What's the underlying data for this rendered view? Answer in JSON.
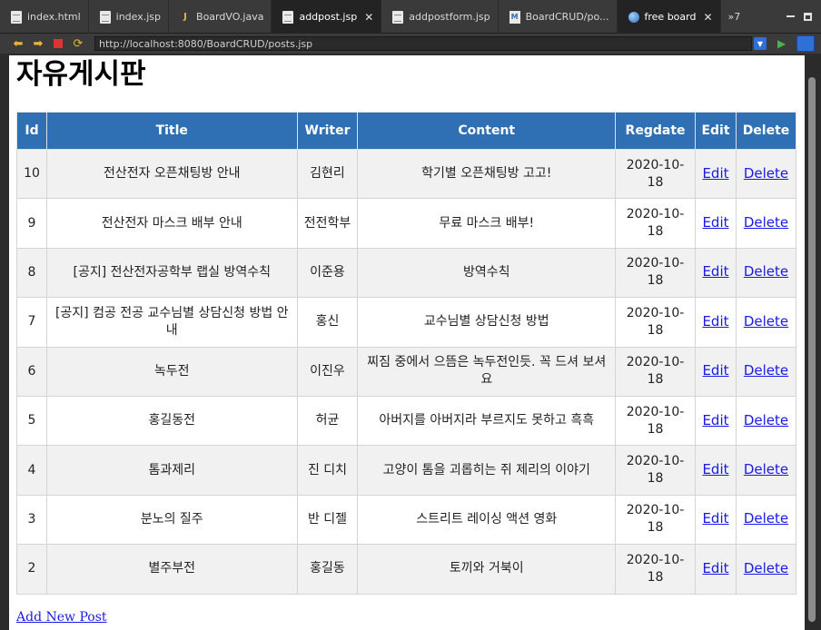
{
  "tabs": [
    {
      "label": "index.html",
      "icon": "html-file-icon",
      "active": false
    },
    {
      "label": "index.jsp",
      "icon": "jsp-file-icon",
      "active": false
    },
    {
      "label": "BoardVO.java",
      "icon": "java-file-icon",
      "active": false
    },
    {
      "label": "addpost.jsp",
      "icon": "jsp-file-icon",
      "active": true,
      "closable": true
    },
    {
      "label": "addpostform.jsp",
      "icon": "jsp-file-icon",
      "active": false
    },
    {
      "label": "BoardCRUD/po...",
      "icon": "web-file-icon",
      "active": false
    },
    {
      "label": "free board",
      "icon": "globe-icon",
      "active": true,
      "closable": true
    }
  ],
  "tab_overflow": "»7",
  "address": {
    "url": "http://localhost:8080/BoardCRUD/posts.jsp"
  },
  "page": {
    "title": "자유게시판",
    "columns": [
      "Id",
      "Title",
      "Writer",
      "Content",
      "Regdate",
      "Edit",
      "Delete"
    ],
    "rows": [
      {
        "id": "10",
        "title": "전산전자 오픈채팅방 안내",
        "writer": "김현리",
        "content": "학기별 오픈채팅방 고고!",
        "regdate": "2020-10-18",
        "edit": "Edit",
        "delete": "Delete"
      },
      {
        "id": "9",
        "title": "전산전자 마스크 배부 안내",
        "writer": "전전학부",
        "content": "무료 마스크 배부!",
        "regdate": "2020-10-18",
        "edit": "Edit",
        "delete": "Delete"
      },
      {
        "id": "8",
        "title": "[공지] 전산전자공학부 랩실 방역수칙",
        "writer": "이준용",
        "content": "방역수칙",
        "regdate": "2020-10-18",
        "edit": "Edit",
        "delete": "Delete"
      },
      {
        "id": "7",
        "title": "[공지] 컴공 전공 교수님별 상담신청 방법 안내",
        "writer": "홍신",
        "content": "교수님별 상담신청 방법",
        "regdate": "2020-10-18",
        "edit": "Edit",
        "delete": "Delete"
      },
      {
        "id": "6",
        "title": "녹두전",
        "writer": "이진우",
        "content": "찌짐 중에서 으뜸은 녹두전인듯. 꼭 드셔 보셔요",
        "regdate": "2020-10-18",
        "edit": "Edit",
        "delete": "Delete"
      },
      {
        "id": "5",
        "title": "홍길동전",
        "writer": "허균",
        "content": "아버지를 아버지라 부르지도 못하고 흑흑",
        "regdate": "2020-10-18",
        "edit": "Edit",
        "delete": "Delete"
      },
      {
        "id": "4",
        "title": "톰과제리",
        "writer": "진 디치",
        "content": "고양이 톰을 괴롭히는 쥐 제리의 이야기",
        "regdate": "2020-10-18",
        "edit": "Edit",
        "delete": "Delete"
      },
      {
        "id": "3",
        "title": "분노의 질주",
        "writer": "반 디젤",
        "content": "스트리트 레이싱 액션 영화",
        "regdate": "2020-10-18",
        "edit": "Edit",
        "delete": "Delete"
      },
      {
        "id": "2",
        "title": "별주부전",
        "writer": "홍길동",
        "content": "토끼와 거북이",
        "regdate": "2020-10-18",
        "edit": "Edit",
        "delete": "Delete"
      }
    ],
    "add_link": "Add New Post"
  },
  "colors": {
    "header_bg": "#2f6fb3",
    "link": "#1a1ae6",
    "row_alt": "#f1f1f1"
  }
}
